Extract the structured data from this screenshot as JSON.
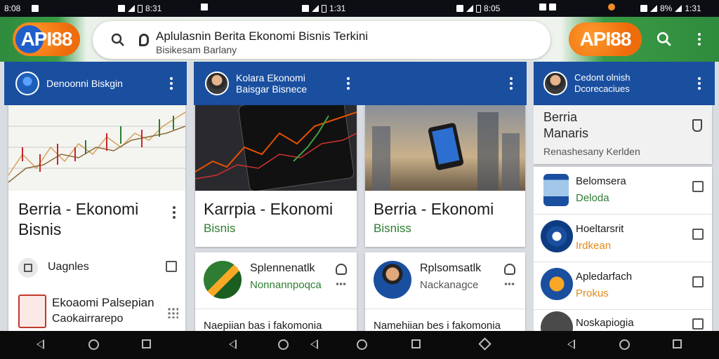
{
  "status_bar": {
    "times": [
      "8:08",
      "8:31",
      "1:31",
      "8:05",
      "1:31"
    ],
    "battery": "8%"
  },
  "app_bar": {
    "logo_text_api": "API",
    "logo_text_num": "88",
    "search_title": "Aplulasnin Berita Ekonomi Bisnis Terkini",
    "search_subtitle": "Bisikesam Barlany"
  },
  "columns": [
    {
      "header": "Denoonni Biskgin",
      "card": {
        "title_line1": "Berria - Ekonomi",
        "title_line2": "Bisnis",
        "subtitle": ""
      },
      "rows": [
        {
          "title": "Uagnles",
          "subtitle": ""
        },
        {
          "title": "Ekoaomi Palsepian",
          "subtitle": "Caokairrarepo"
        }
      ]
    },
    {
      "header_line1": "Kolara Ekonomi",
      "header_line2": "Baisgar Bisnece",
      "card": {
        "title_line1": "Karrpia - Ekonomi",
        "subtitle": "Bisnis"
      },
      "rows": [
        {
          "title": "Splennenatlk",
          "subtitle": "Nonnannpoqca"
        },
        {
          "title": "Naepiian bas i fakomonia",
          "subtitle": ""
        }
      ]
    },
    {
      "card": {
        "title_line1": "Berria - Ekonomi",
        "subtitle": "Bisniss"
      },
      "rows": [
        {
          "title": "Rplsomsatlk",
          "subtitle": "Nackanagce"
        },
        {
          "title": "Namehiian bes i fakomonia",
          "subtitle": ""
        }
      ]
    },
    {
      "header_line1": "Cedont olnish",
      "header_line2": "Dcorecaciues",
      "card": {
        "title_line1": "Berria",
        "title_line2": "Manaris",
        "subtitle": "Renashesany Kerlden"
      },
      "rows": [
        {
          "title": "Belomsera",
          "subtitle": "Deloda"
        },
        {
          "title": "Hoeltarsrit",
          "subtitle": "Irdkean"
        },
        {
          "title": "Apledarfach",
          "subtitle": "Prokus"
        },
        {
          "title": "Noskapiogia",
          "subtitle": ""
        }
      ]
    }
  ],
  "colors": {
    "header_blue": "#1a4fa0",
    "brand_green": "#2f8b3d",
    "logo_orange": "#ef6c0c",
    "subtitle_green": "#2e7d32",
    "subtitle_orange": "#e08a1a"
  }
}
